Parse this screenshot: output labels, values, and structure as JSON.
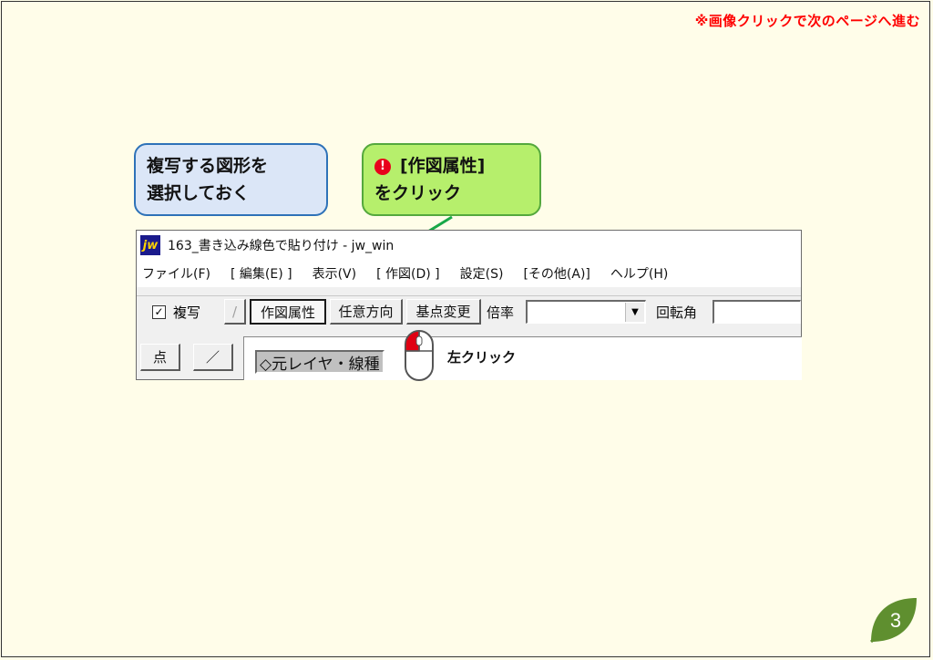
{
  "nav_note": "※画像クリックで次のページへ進む",
  "callout_left": {
    "line1": "複写する図形を",
    "line2": "選択しておく"
  },
  "callout_right": {
    "badge": "❶",
    "line1": "[作図属性]",
    "line2": "をクリック"
  },
  "window": {
    "app_icon_text": "jw",
    "title": "163_書き込み線色で貼り付け - jw_win",
    "menus": [
      "ファイル(F)",
      "[ 編集(E) ]",
      "表示(V)",
      "[ 作図(D) ]",
      "設定(S)",
      "[その他(A)]",
      "ヘルプ(H)"
    ],
    "toolbar": {
      "copy_checkbox_checked": true,
      "copy_label": "複写",
      "slash_button": "/",
      "attr_button": "作図属性",
      "direction_button": "任意方向",
      "base_button": "基点変更",
      "scale_label": "倍率",
      "scale_value": "",
      "rotation_label": "回転角",
      "rotation_value": ""
    },
    "row2": {
      "point_button": "点",
      "line_button": "／",
      "layer_label": "◇元レイヤ・線種"
    }
  },
  "mouse_label": "左クリック",
  "page_number": "3",
  "colors": {
    "accent_red": "#ff0000",
    "callout_blue_bg": "#dbe6f7",
    "callout_green_bg": "#b6ef6c",
    "leaf_green": "#5f8f2f"
  }
}
